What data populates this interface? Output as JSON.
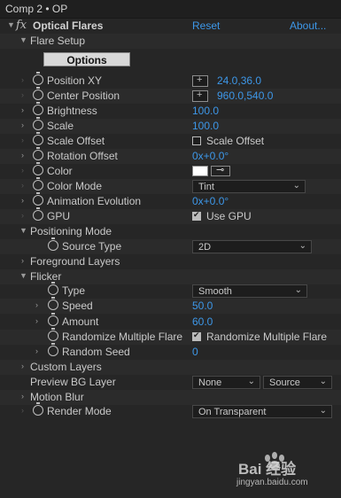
{
  "header": {
    "title": "Comp 2 • OP"
  },
  "effect": {
    "name": "Optical Flares",
    "fx_icon": "fx",
    "reset": "Reset",
    "about": "About..."
  },
  "flare_setup": {
    "label": "Flare Setup",
    "options_button": "Options"
  },
  "params": {
    "position_xy": {
      "label": "Position XY",
      "value": "24.0,36.0"
    },
    "center_position": {
      "label": "Center Position",
      "value": "960.0,540.0"
    },
    "brightness": {
      "label": "Brightness",
      "value": "100.0"
    },
    "scale": {
      "label": "Scale",
      "value": "100.0"
    },
    "scale_offset": {
      "label": "Scale Offset",
      "checkbox": "Scale Offset"
    },
    "rotation_offset": {
      "label": "Rotation Offset",
      "value": "0x+0.0°"
    },
    "color": {
      "label": "Color",
      "swatch": "#ffffff"
    },
    "color_mode": {
      "label": "Color Mode",
      "value": "Tint"
    },
    "animation_evolution": {
      "label": "Animation Evolution",
      "value": "0x+0.0°"
    },
    "gpu": {
      "label": "GPU",
      "checkbox": "Use GPU"
    }
  },
  "positioning_mode": {
    "label": "Positioning Mode",
    "source_type_label": "Source Type",
    "source_type_value": "2D"
  },
  "foreground_layers": {
    "label": "Foreground Layers"
  },
  "flicker": {
    "label": "Flicker",
    "type_label": "Type",
    "type_value": "Smooth",
    "speed_label": "Speed",
    "speed_value": "50.0",
    "amount_label": "Amount",
    "amount_value": "60.0",
    "randomize_label": "Randomize Multiple Flare",
    "randomize_checkbox": "Randomize Multiple Flare",
    "seed_label": "Random Seed",
    "seed_value": "0"
  },
  "custom_layers": {
    "label": "Custom Layers"
  },
  "preview_bg": {
    "label": "Preview BG Layer",
    "layer_value": "None",
    "source_value": "Source"
  },
  "motion_blur": {
    "label": "Motion Blur"
  },
  "render_mode": {
    "label": "Render Mode",
    "value": "On Transparent"
  },
  "watermark": {
    "text": "Bai 经验",
    "url": "jingyan.baidu.com"
  },
  "colors": {
    "accent": "#3d97e8",
    "background": "#262626"
  }
}
